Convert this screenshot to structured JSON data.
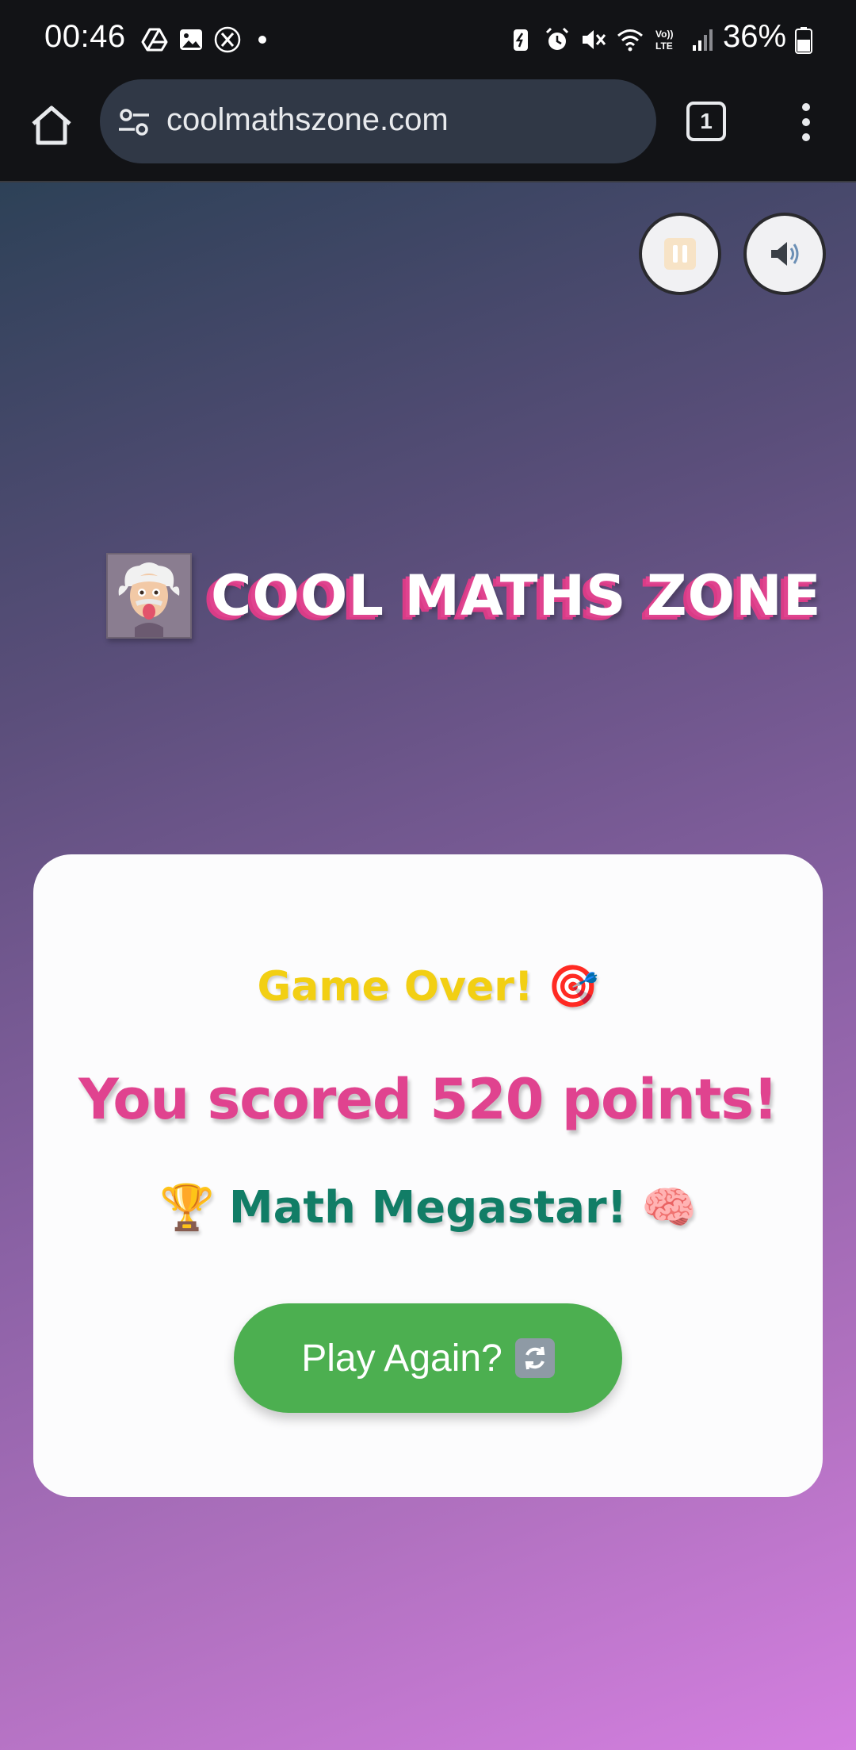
{
  "status_bar": {
    "time": "00:46",
    "battery_percent": "36%",
    "left_icons": [
      "drive-icon",
      "gallery-icon",
      "x-icon",
      "dot-icon"
    ],
    "right_icons": [
      "battery-saver-icon",
      "alarm-icon",
      "mute-icon",
      "wifi-icon",
      "volte-icon",
      "signal-icon",
      "battery-icon"
    ],
    "volte_label": "Vo)) LTE"
  },
  "browser": {
    "url": "coolmathszone.com",
    "tab_count": "1"
  },
  "game": {
    "brand_title": "COOL MATHS ZONE",
    "game_over": "Game Over! 🎯",
    "score_text": "You scored 520 points!",
    "rank_text": "Math Megastar!",
    "play_again_label": "Play Again?"
  },
  "colors": {
    "accent_pink": "#e0438f",
    "game_over_yellow": "#f2cf13",
    "rank_green": "#117d66",
    "play_button_green": "#4caf50",
    "card_background": "#fcfcfd"
  }
}
